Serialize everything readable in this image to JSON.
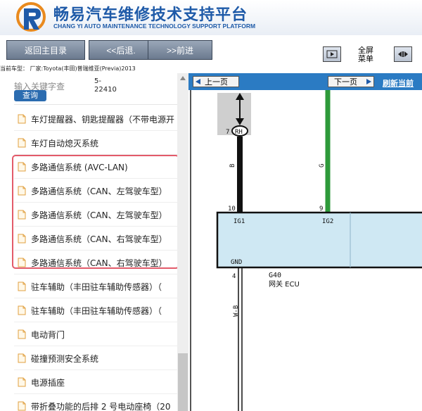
{
  "header": {
    "title": "畅易汽车维修技术支持平台",
    "subtitle": "CHANG YI AUTO MAINTENANCE TECHNOLOGY SUPPORT PLATFORM",
    "brand_color": "#1e5aa8"
  },
  "toolbar": {
    "home_label": "返回主目录",
    "back_label": "<<后退.",
    "forward_label": ">>前进",
    "fullscreen_line1": "全屏",
    "fullscreen_line2": "菜单"
  },
  "vehicle_line": "当前车型：  厂家:Toyota(丰田)普瑞维亚(Previa)2013",
  "sidebar": {
    "search_placeholder": "输入关键字查",
    "search_button": "查询",
    "code_line1": "5-",
    "code_line2": "22410",
    "items": [
      {
        "label": "车灯提醒器、钥匙提醒器（不带电源开"
      },
      {
        "label": "车灯自动熄灭系统"
      },
      {
        "label": "多路通信系统 (AVC-LAN)"
      },
      {
        "label": "多路通信系统（CAN、左驾驶车型）"
      },
      {
        "label": "多路通信系统（CAN、左驾驶车型）"
      },
      {
        "label": "多路通信系统（CAN、右驾驶车型）"
      },
      {
        "label": "多路通信系统（CAN、右驾驶车型）"
      },
      {
        "label": "驻车辅助（丰田驻车辅助传感器）（"
      },
      {
        "label": "驻车辅助（丰田驻车辅助传感器）（"
      },
      {
        "label": "电动背门"
      },
      {
        "label": "碰撞预测安全系统"
      },
      {
        "label": "电源插座"
      },
      {
        "label": "带折叠功能的后排 2 号电动座椅（20"
      }
    ],
    "highlight_color": "#e35b6a"
  },
  "main": {
    "prev_label": "上一页",
    "next_label": "下一页",
    "refresh_label": "刷新当前",
    "diagram": {
      "pin_rh_num": "7",
      "pin_rh": "RH",
      "wire_b": "B",
      "wire_g": "G",
      "pin_10": "10",
      "pin_9": "9",
      "ig1": "IG1",
      "ig2": "IG2",
      "gnd": "GND",
      "pin_4": "4",
      "wire_wb": "W-B",
      "ecu_code": "G40",
      "ecu_name": "网关 ECU",
      "wire_b_color": "#111111",
      "wire_g_color": "#2e9a3a",
      "ecu_fill": "#cfe8f3"
    }
  }
}
